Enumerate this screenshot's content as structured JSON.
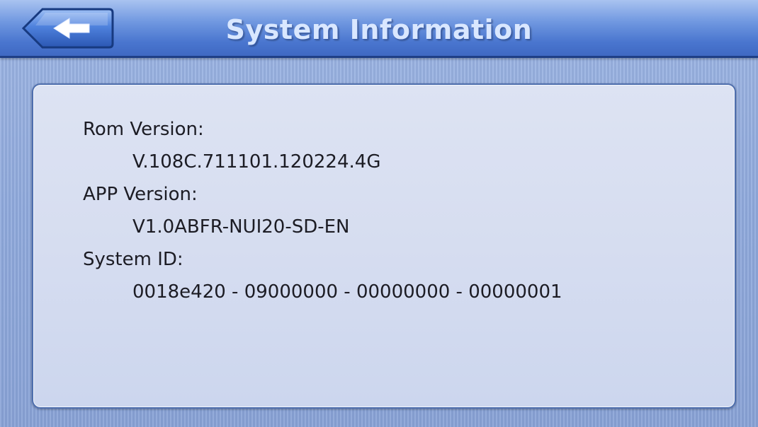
{
  "header": {
    "title": "System Information",
    "back_icon": "back-arrow-icon"
  },
  "info": {
    "items": [
      {
        "label": "Rom Version:",
        "value": "V.108C.711101.120224.4G"
      },
      {
        "label": "APP Version:",
        "value": "V1.0ABFR-NUI20-SD-EN"
      },
      {
        "label": "System ID:",
        "value": "0018e420 - 09000000 - 00000000 - 00000001"
      }
    ]
  },
  "colors": {
    "header_blue": "#4a76cf",
    "panel_bg": "#d6ddf0",
    "panel_border": "#4f6fae",
    "title_text": "#d9e7ff"
  }
}
